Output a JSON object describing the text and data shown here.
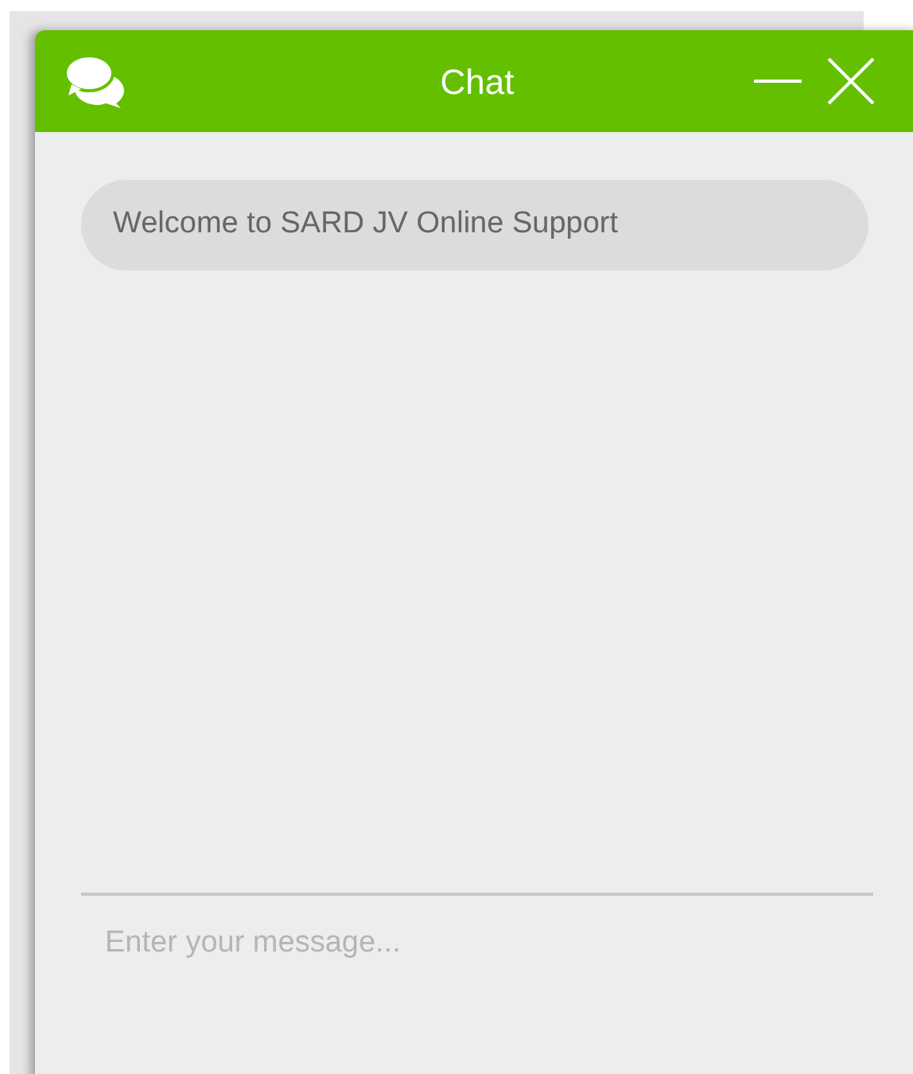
{
  "window": {
    "title": "Chat"
  },
  "messages": [
    {
      "text": "Welcome to SARD JV Online Support"
    }
  ],
  "input": {
    "placeholder": "Enter your message..."
  }
}
